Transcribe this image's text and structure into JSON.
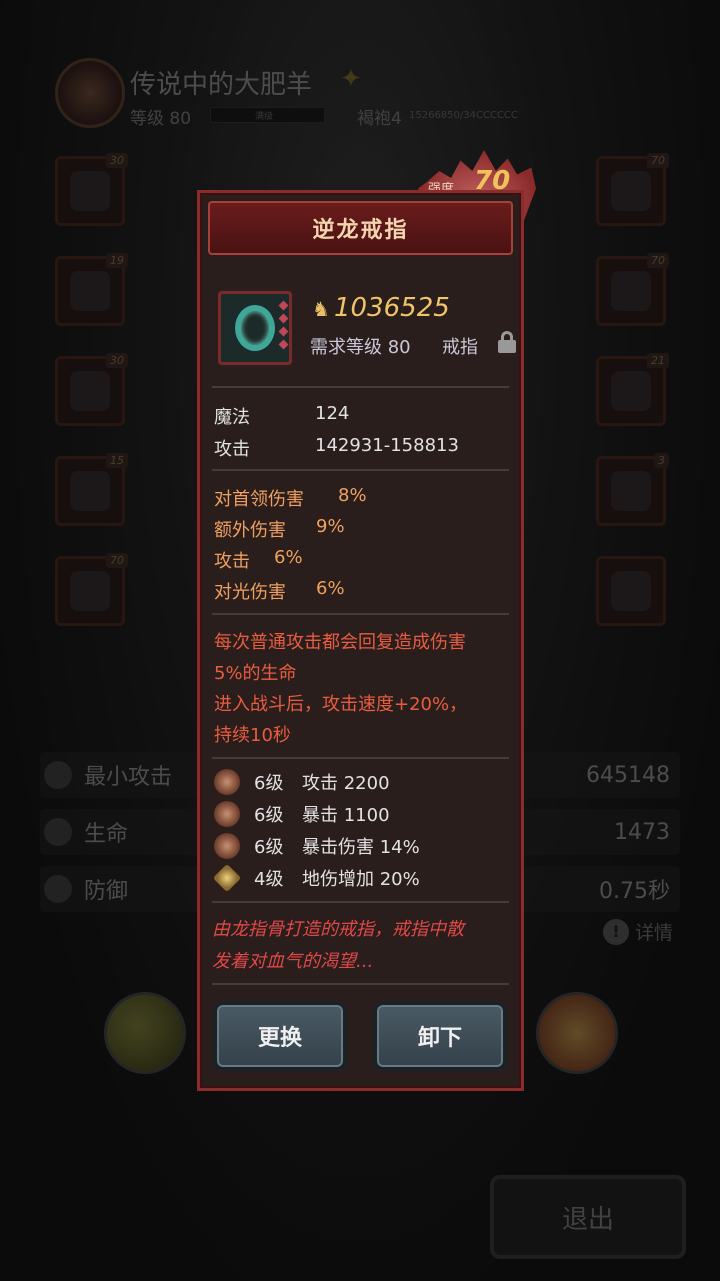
{
  "header": {
    "player_name": "传说中的大肥羊",
    "level_label": "等级 80",
    "bar_text": "满级",
    "class_label": "褐袍4",
    "exp_text": "15266850/34CCCCCC"
  },
  "left_slots": [
    {
      "level": "30"
    },
    {
      "level": "19"
    },
    {
      "level": "30"
    },
    {
      "level": "15"
    },
    {
      "level": "70"
    }
  ],
  "right_slots": [
    {
      "level": "70"
    },
    {
      "level": "70"
    },
    {
      "level": "21"
    },
    {
      "level": "3"
    },
    {
      "level": ""
    }
  ],
  "stats": [
    {
      "icon": "sword-icon",
      "label": "最小攻击",
      "value": "645148"
    },
    {
      "icon": "heart-icon",
      "label": "生命",
      "value": "1473"
    },
    {
      "icon": "shield-icon",
      "label": "防御",
      "value": "0.75秒"
    }
  ],
  "details_label": "详情",
  "exit_label": "退出",
  "modal": {
    "title": "逆龙戒指",
    "strength_label": "强度",
    "strength_value": "70",
    "price": "1036525",
    "requirement": "需求等级 80",
    "slot_type": "戒指",
    "base_stats": [
      {
        "name": "魔法",
        "value": "124"
      },
      {
        "name": "攻击",
        "value": "142931-158813"
      }
    ],
    "bonus_stats": [
      {
        "name": "对首领伤害",
        "value": "8%"
      },
      {
        "name": "额外伤害",
        "value": "9%"
      },
      {
        "name": "攻击",
        "value": "6%"
      },
      {
        "name": "对光伤害",
        "value": "6%"
      }
    ],
    "special_lines": [
      "每次普通攻击都会回复造成伤害",
      "5%的生命",
      "进入战斗后，攻击速度+20%，",
      "持续10秒"
    ],
    "gems": [
      {
        "level": "6级",
        "effect": "攻击 2200"
      },
      {
        "level": "6级",
        "effect": "暴击 1100"
      },
      {
        "level": "6级",
        "effect": "暴击伤害 14%"
      },
      {
        "level": "4级",
        "effect": "地伤增加 20%"
      }
    ],
    "description_lines": [
      "由龙指骨打造的戒指，戒指中散",
      "发着对血气的渴望..."
    ],
    "replace_label": "更换",
    "unequip_label": "卸下"
  },
  "colors": {
    "modal_border": "#8a2c2c",
    "price": "#f0c468",
    "bonus": "#f0a060",
    "special": "#e85c40",
    "button": "#3d4c56"
  }
}
